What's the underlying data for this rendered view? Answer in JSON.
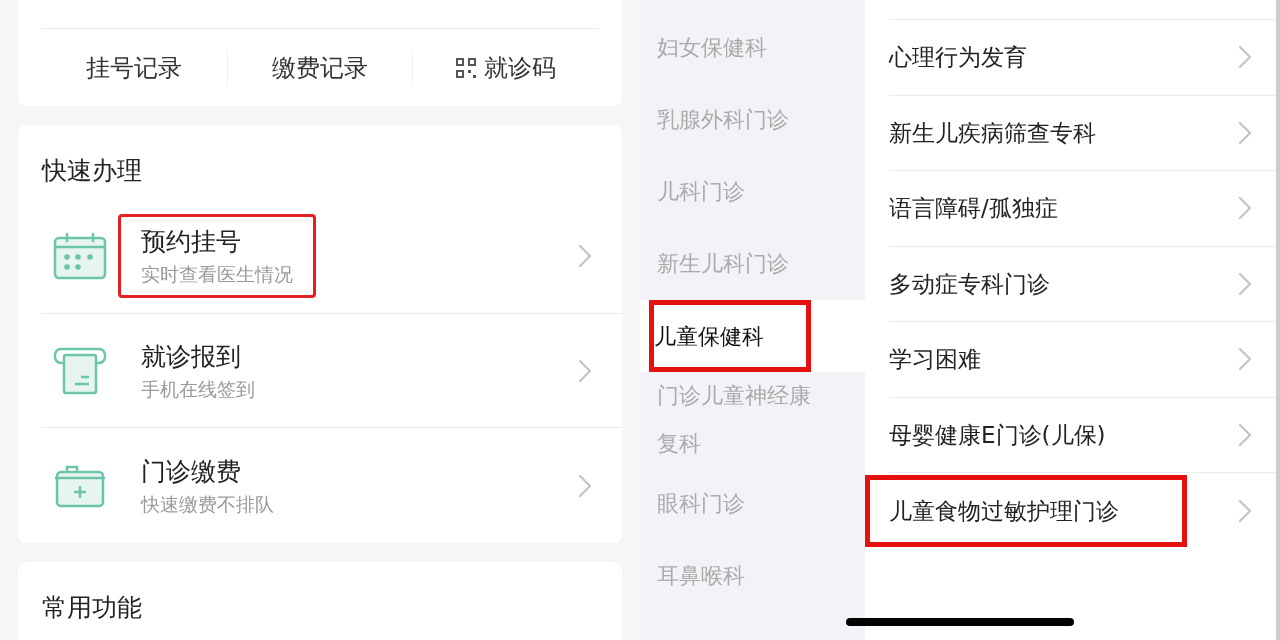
{
  "records": [
    {
      "label": "挂号记录",
      "kind": "plain"
    },
    {
      "label": "缴费记录",
      "kind": "plain"
    },
    {
      "label": "就诊码",
      "kind": "code"
    }
  ],
  "quick": {
    "title": "快速办理",
    "items": [
      {
        "title": "预约挂号",
        "subtitle": "实时查看医生情况",
        "highlighted": true
      },
      {
        "title": "就诊报到",
        "subtitle": "手机在线签到",
        "highlighted": false
      },
      {
        "title": "门诊缴费",
        "subtitle": "快速缴费不排队",
        "highlighted": false
      }
    ]
  },
  "common": {
    "title": "常用功能"
  },
  "departments": [
    {
      "label": "妇女保健科",
      "selected": false,
      "highlighted": false
    },
    {
      "label": "乳腺外科门诊",
      "selected": false,
      "highlighted": false
    },
    {
      "label": "儿科门诊",
      "selected": false,
      "highlighted": false
    },
    {
      "label": "新生儿科门诊",
      "selected": false,
      "highlighted": false
    },
    {
      "label": "儿童保健科",
      "selected": true,
      "highlighted": true
    },
    {
      "label": "门诊儿童神经康复科",
      "selected": false,
      "highlighted": false
    },
    {
      "label": "眼科门诊",
      "selected": false,
      "highlighted": false
    },
    {
      "label": "耳鼻喉科",
      "selected": false,
      "highlighted": false
    }
  ],
  "clinics": [
    {
      "label": "心理行为发育",
      "highlighted": false
    },
    {
      "label": "新生儿疾病筛查专科",
      "highlighted": false
    },
    {
      "label": "语言障碍/孤独症",
      "highlighted": false
    },
    {
      "label": "多动症专科门诊",
      "highlighted": false
    },
    {
      "label": "学习困难",
      "highlighted": false
    },
    {
      "label": "母婴健康E门诊(儿保)",
      "highlighted": false
    },
    {
      "label": "儿童食物过敏护理门诊",
      "highlighted": true
    }
  ]
}
